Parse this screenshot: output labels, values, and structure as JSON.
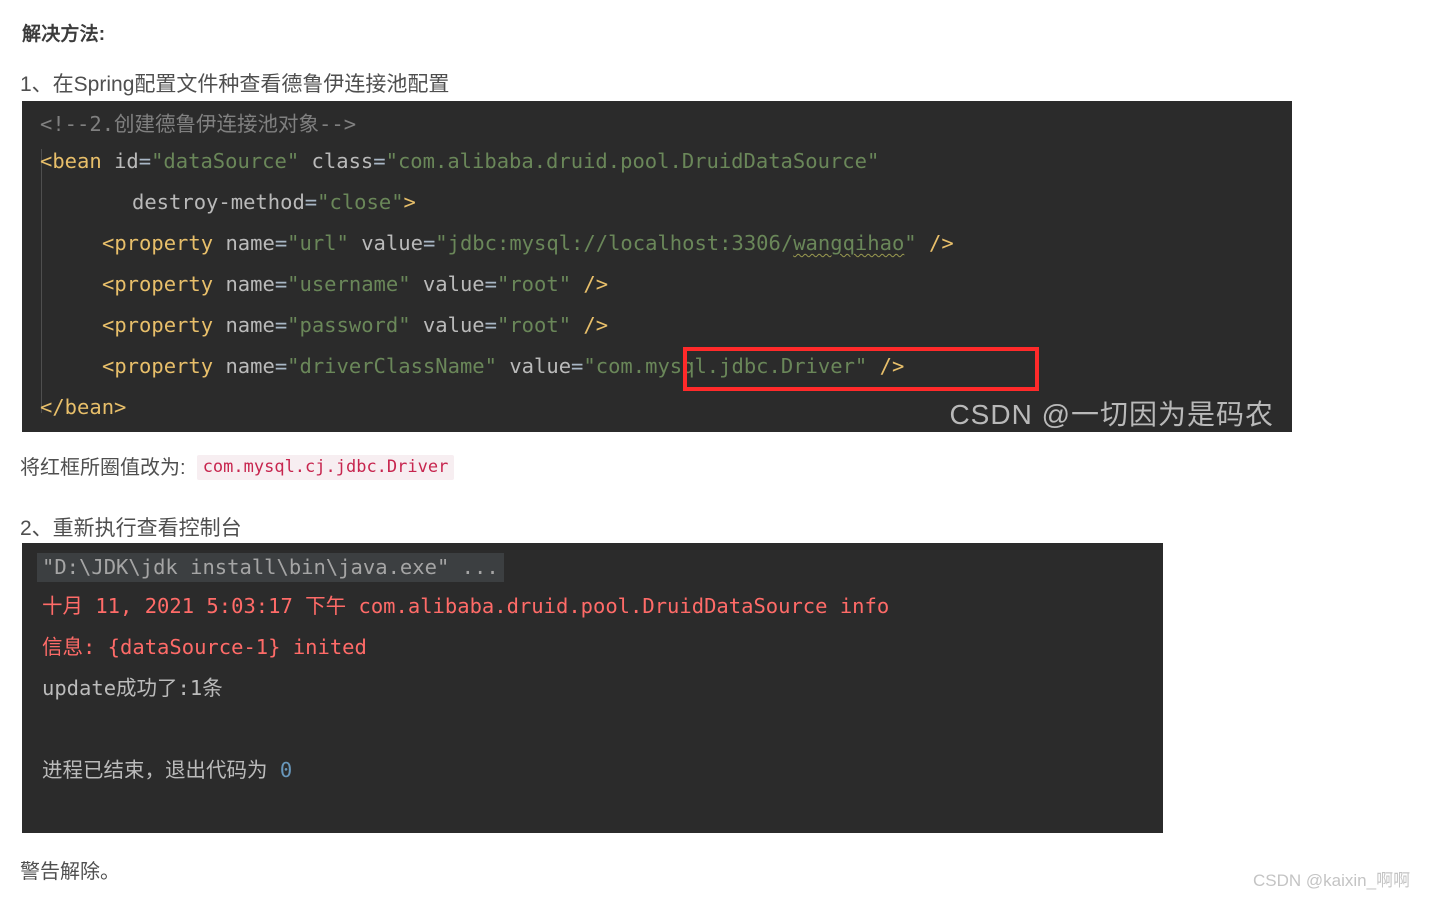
{
  "document": {
    "solution_heading": "解决方法:",
    "step1_heading": "1、在Spring配置文件种查看德鲁伊连接池配置",
    "fix_prefix": "将红框所圈值改为:",
    "fix_code": "com.mysql.cj.jdbc.Driver",
    "step2_heading": "2、重新执行查看控制台",
    "conclusion": "警告解除。"
  },
  "code_block": {
    "language": "xml",
    "lines": [
      {
        "id": "l1",
        "type": "comment",
        "text": "<!--2.创建德鲁伊连接池对象-->"
      },
      {
        "id": "l2",
        "type": "tag_open",
        "tag": "<bean",
        "attr1": "id",
        "val1": "\"dataSource\"",
        "attr2": "class",
        "val2": "\"com.alibaba.druid.pool.DruidDataSource\""
      },
      {
        "id": "l3",
        "type": "attr_cont",
        "attr": "destroy-method",
        "val": "\"close\"",
        "close": ">"
      },
      {
        "id": "l4",
        "type": "property",
        "tag": "<property",
        "attr1": "name",
        "val1": "\"url\"",
        "attr2": "value",
        "val2": "\"jdbc:mysql://localhost:3306/wangqihao\"",
        "squiggle": "wangqihao",
        "selfclose": "/>"
      },
      {
        "id": "l5",
        "type": "property",
        "tag": "<property",
        "attr1": "name",
        "val1": "\"username\"",
        "attr2": "value",
        "val2": "\"root\"",
        "selfclose": "/>"
      },
      {
        "id": "l6",
        "type": "property",
        "tag": "<property",
        "attr1": "name",
        "val1": "\"password\"",
        "attr2": "value",
        "val2": "\"root\"",
        "selfclose": "/>"
      },
      {
        "id": "l7",
        "type": "property",
        "tag": "<property",
        "attr1": "name",
        "val1": "\"driverClassName\"",
        "attr2": "value",
        "val2": "\"com.mysql.jdbc.Driver\"",
        "selfclose": "/>"
      },
      {
        "id": "l8",
        "type": "tag_close",
        "tag": "</bean>"
      }
    ],
    "highlight_box": {
      "label": "driver-class-value-highlight",
      "color": "#ff2a2a",
      "target_text": "\"com.mysql.jdbc.Driver\""
    },
    "watermark": "CSDN @一切因为是码农",
    "colors": {
      "background": "#2b2b2b",
      "comment": "#808080",
      "tag": "#e8bf6a",
      "attribute": "#bababa",
      "value": "#6a8759"
    }
  },
  "console_block": {
    "lines": [
      {
        "id": "c1",
        "style": "command",
        "text": "\"D:\\JDK\\jdk install\\bin\\java.exe\" ..."
      },
      {
        "id": "c2",
        "style": "error",
        "text": "十月 11, 2021 5:03:17 下午 com.alibaba.druid.pool.DruidDataSource info"
      },
      {
        "id": "c3",
        "style": "error",
        "text": "信息: {dataSource-1} inited"
      },
      {
        "id": "c4",
        "style": "output",
        "text": "update成功了:1条"
      },
      {
        "id": "c5",
        "style": "output",
        "text": "进程已结束，退出代码为 ",
        "exit_code": "0"
      }
    ],
    "colors": {
      "background": "#2b2b2b",
      "command_bg": "#3c3f41",
      "command_fg": "#a5a5a5",
      "error": "#ff6b68",
      "output": "#bbbbbb",
      "number": "#6897bb"
    }
  },
  "page_watermark": "CSDN @kaixin_啊啊"
}
